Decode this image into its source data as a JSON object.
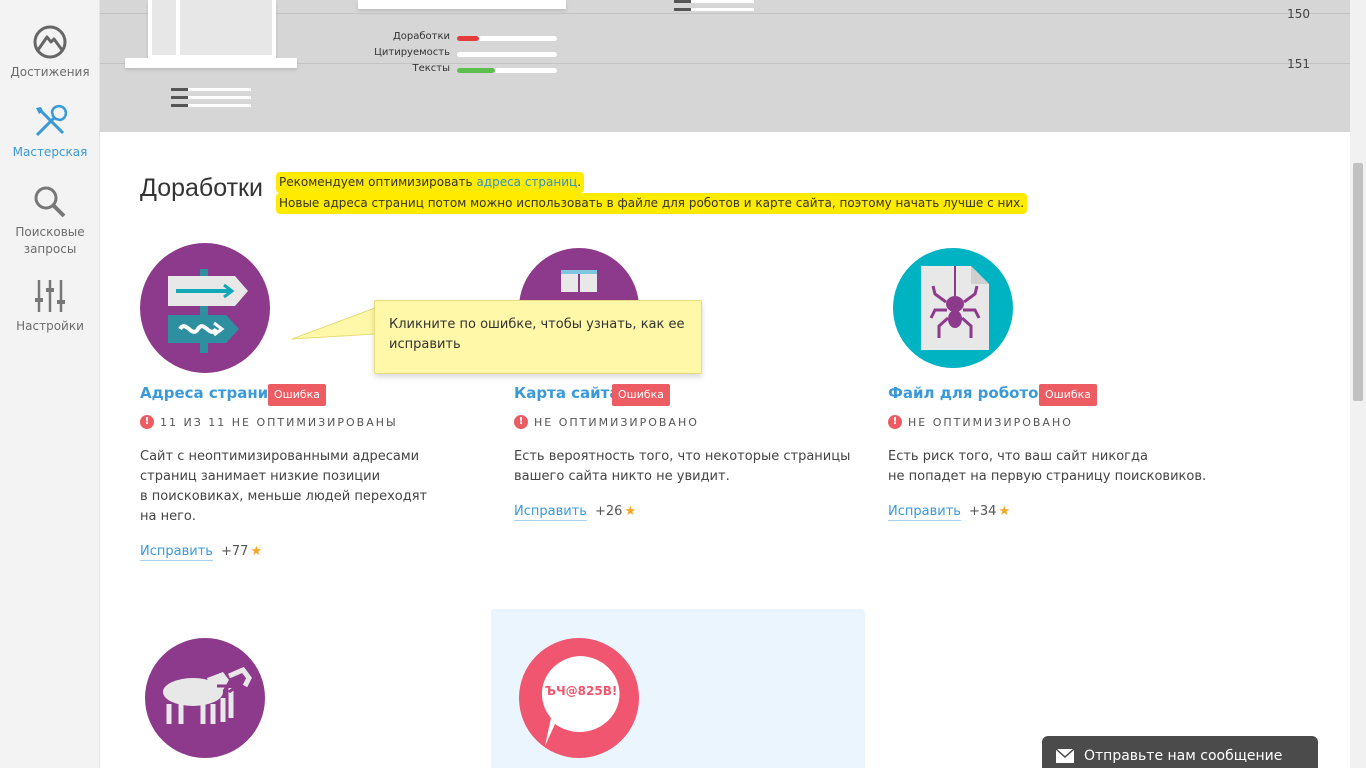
{
  "sidebar": {
    "items": [
      {
        "label": "Достижения",
        "icon": "mountain-icon"
      },
      {
        "label": "Мастерская",
        "icon": "tools-icon",
        "active": true
      },
      {
        "label": "Поисковые запросы",
        "icon": "search-icon"
      },
      {
        "label": "Настройки",
        "icon": "sliders-icon"
      }
    ]
  },
  "chart_area": {
    "y_labels": [
      "150",
      "151"
    ],
    "bars": [
      {
        "label": "Доработки",
        "value": 0.22,
        "color": "#e63b3b"
      },
      {
        "label": "Цитируемость",
        "value": 0.0,
        "color": "#e63b3b"
      },
      {
        "label": "Тексты",
        "value": 0.38,
        "color": "#5cbf4d"
      }
    ]
  },
  "section": {
    "title": "Доработки",
    "recommend": {
      "line1_prefix": "Рекомендуем оптимизировать ",
      "line1_link": "адреса страниц",
      "line1_suffix": ".",
      "line2": "Новые адреса страниц потом можно использовать в файле для роботов и карте сайта, поэтому начать лучше с них."
    }
  },
  "tooltip": {
    "text": "Кликните по ошибке, чтобы узнать, как ее исправить"
  },
  "cards": [
    {
      "title": "Адреса страниц",
      "badge": "Ошибка",
      "status": "11 ИЗ 11 НЕ ОПТИМИЗИРОВАНЫ",
      "desc": "Сайт с неоптимизированными адресами\nстраниц занимает низкие позиции\nв поисковиках, меньше людей переходят\nна него.",
      "fix": "Исправить",
      "points": "+77",
      "icon_color": "#8e3a8c"
    },
    {
      "title": "Карта сайта",
      "badge": "Ошибка",
      "status": "НЕ ОПТИМИЗИРОВАНО",
      "desc": "Есть вероятность того, что некоторые страницы\nвашего сайта никто не увидит.",
      "fix": "Исправить",
      "points": "+26",
      "icon_color": "#8e3a8c"
    },
    {
      "title": "Файл для роботов",
      "badge": "Ошибка",
      "status": "НЕ ОПТИМИЗИРОВАНО",
      "desc": "Есть риск того, что ваш сайт никогда\nне попадет на первую страницу поисковиков.",
      "fix": "Исправить",
      "points": "+34",
      "icon_color": "#00b3c2"
    }
  ],
  "bottom": {
    "card4_icon_color": "#8e3a8c",
    "card5_icon_color": "#f0566f",
    "card5_bubble_text": "ЪЧ@825В!"
  },
  "chat": {
    "label": "Отправьте нам сообщение"
  }
}
